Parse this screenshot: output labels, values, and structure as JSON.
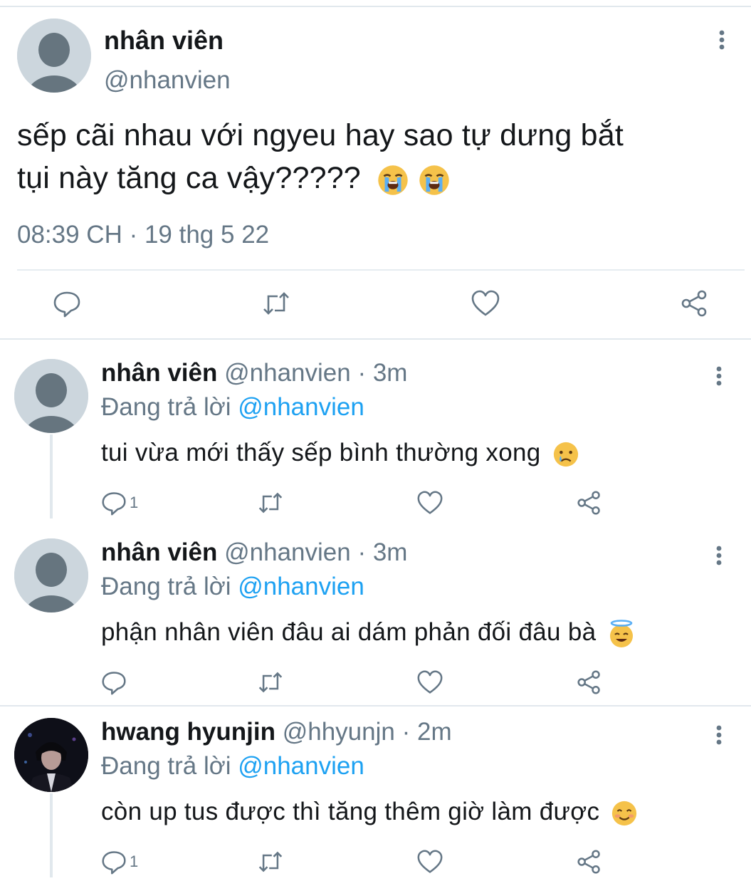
{
  "main_tweet": {
    "author_name": "nhân viên",
    "author_handle": "@nhanvien",
    "text_line1": "sếp cãi nhau với ngyeu hay sao tự dưng bắt",
    "text_line2": "tụi này tăng ca vậy?????",
    "emojis": [
      "loudly-crying-face",
      "loudly-crying-face"
    ],
    "timestamp": "08:39 CH · 19 thg 5 22",
    "actions": [
      "reply-icon",
      "retweet-icon",
      "like-icon",
      "share-icon"
    ]
  },
  "replies": [
    {
      "author_name": "nhân viên",
      "author_handle": "@nhanvien",
      "time_ago": "· 3m",
      "replying_label": "Đang trả lời",
      "replying_to": "@nhanvien",
      "text": "tui vừa mới thấy sếp bình thường xong",
      "emoji": "crying-face",
      "reply_count": "1",
      "avatar": "default-avatar"
    },
    {
      "author_name": "nhân viên",
      "author_handle": "@nhanvien",
      "time_ago": "· 3m",
      "replying_label": "Đang trả lời",
      "replying_to": "@nhanvien",
      "text": "phận nhân viên đâu ai dám phản đối đâu bà",
      "emoji": "smiling-face-with-halo",
      "reply_count": "",
      "avatar": "default-avatar"
    },
    {
      "author_name": "hwang hyunjin",
      "author_handle": "@hhyunjn",
      "time_ago": "· 2m",
      "replying_label": "Đang trả lời",
      "replying_to": "@nhanvien",
      "text": "còn up tus được thì tăng thêm giờ làm được",
      "emoji": "smiling-face-with-smiling-eyes",
      "reply_count": "1",
      "avatar": "profile-photo"
    }
  ],
  "colors": {
    "text": "#14171a",
    "secondary": "#657786",
    "link": "#1da1f2",
    "divider": "#e1e8ed",
    "icon": "#657786",
    "avatar_bg": "#ccd6dd",
    "avatar_fg": "#657786"
  }
}
